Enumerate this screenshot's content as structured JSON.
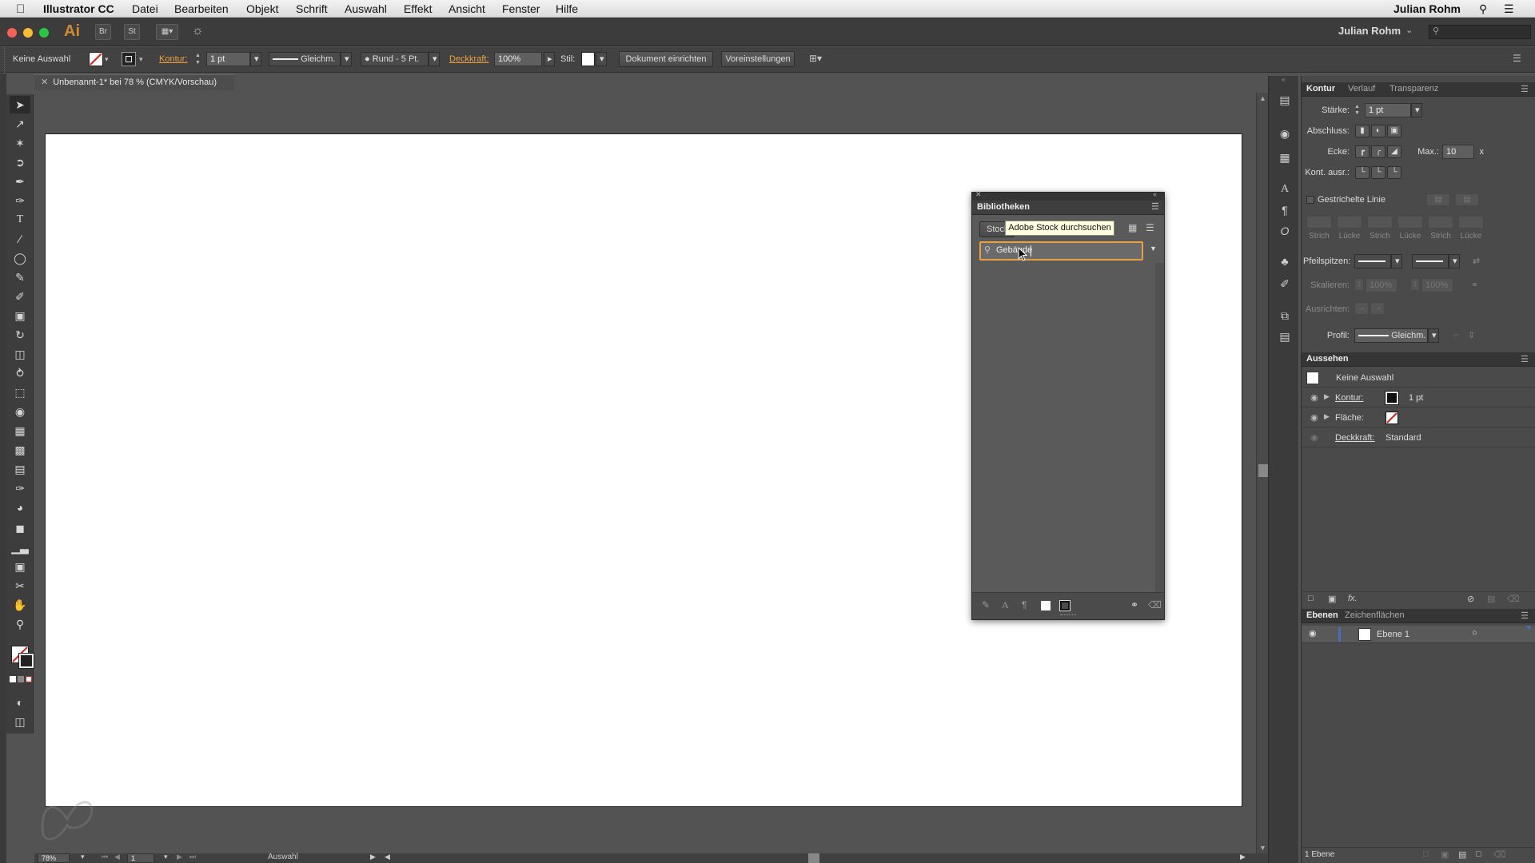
{
  "menubar": {
    "app_name": "Illustrator CC",
    "items": [
      "Datei",
      "Bearbeiten",
      "Objekt",
      "Schrift",
      "Auswahl",
      "Effekt",
      "Ansicht",
      "Fenster",
      "Hilfe"
    ],
    "user": "Julian Rohm"
  },
  "appbar": {
    "logo": "Ai",
    "bridge": "Br",
    "stock": "St",
    "user": "Julian Rohm",
    "search_placeholder": ""
  },
  "control": {
    "selection": "Keine Auswahl",
    "kontur_label": "Kontur:",
    "kontur_value": "1 pt",
    "profile": "Gleichm.",
    "brush": "Rund - 5 Pt.",
    "deckkraft_label": "Deckkraft:",
    "deckkraft_value": "100%",
    "stil_label": "Stil:",
    "doc_setup": "Dokument einrichten",
    "prefs": "Voreinstellungen"
  },
  "document": {
    "tab_title": "Unbenannt-1* bei 78 % (CMYK/Vorschau)"
  },
  "status": {
    "zoom": "78%",
    "page": "1",
    "tool": "Auswahl"
  },
  "stroke_panel": {
    "tabs": [
      "Kontur",
      "Verlauf",
      "Transparenz"
    ],
    "staerke_label": "Stärke:",
    "staerke_value": "1 pt",
    "abschluss_label": "Abschluss:",
    "ecke_label": "Ecke:",
    "max_label": "Max.:",
    "max_value": "10",
    "max_unit": "x",
    "kont_label": "Kont. ausr.:",
    "dashed_label": "Gestrichelte Linie",
    "dash_labels": [
      "Strich",
      "Lücke",
      "Strich",
      "Lücke",
      "Strich",
      "Lücke"
    ],
    "arrow_label": "Pfeilspitzen:",
    "scale_label": "Skalieren:",
    "scale_values": [
      "100%",
      "100%"
    ],
    "align_label": "Ausrichten:",
    "profile_label": "Profil:",
    "profile_value": "Gleichm."
  },
  "appearance_panel": {
    "title": "Aussehen",
    "selection": "Keine Auswahl",
    "kontur_label": "Kontur:",
    "kontur_value": "1 pt",
    "flaeche_label": "Fläche:",
    "deckkraft_label": "Deckkraft:",
    "deckkraft_value": "Standard"
  },
  "layers_panel": {
    "tabs": [
      "Ebenen",
      "Zeichenflächen"
    ],
    "layer_name": "Ebene 1",
    "footer_count": "1 Ebene"
  },
  "libraries_panel": {
    "title": "Bibliotheken",
    "stock_tab": "Stock",
    "tooltip": "Adobe Stock durchsuchen",
    "search_value": "Gebäude"
  },
  "colors": {
    "accent_orange": "#f0a040",
    "layer_blue": "#4a6fb5",
    "artboard": "#ffffff"
  }
}
